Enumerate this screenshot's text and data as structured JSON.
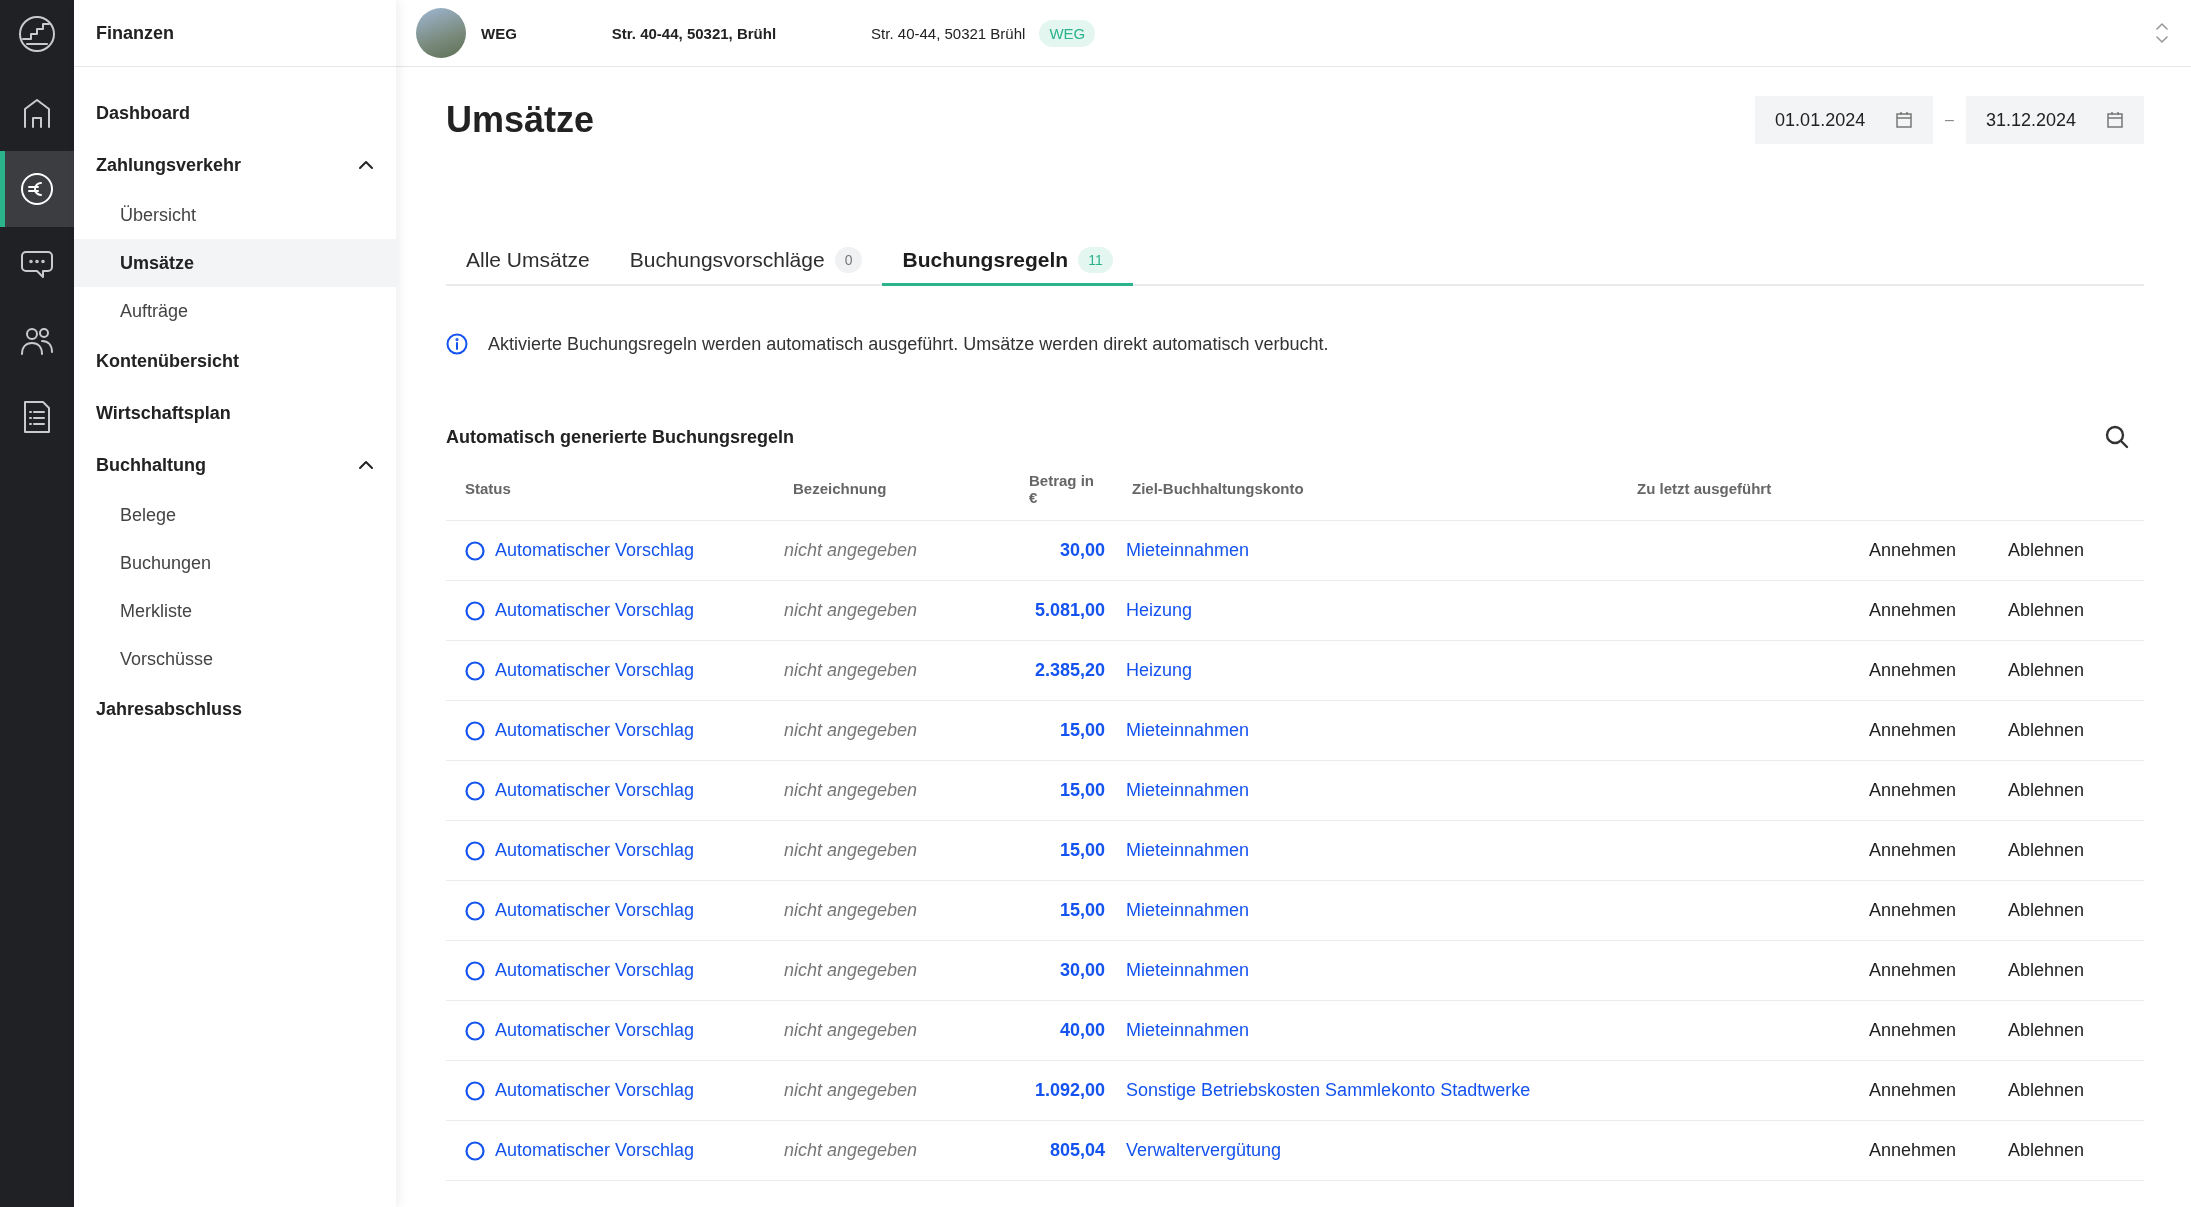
{
  "rail": [
    {
      "kind": "logo",
      "selected": false
    },
    {
      "kind": "home",
      "selected": false
    },
    {
      "kind": "euro",
      "selected": true
    },
    {
      "kind": "chat",
      "selected": false
    },
    {
      "kind": "people",
      "selected": false
    },
    {
      "kind": "document",
      "selected": false
    }
  ],
  "sidebar": {
    "title": "Finanzen",
    "items": [
      {
        "label": "Dashboard",
        "selected": false
      },
      {
        "label": "Zahlungsverkehr",
        "selected": false,
        "expanded": true,
        "children": [
          {
            "label": "Übersicht",
            "selected": false
          },
          {
            "label": "Umsätze",
            "selected": true
          },
          {
            "label": "Aufträge",
            "selected": false
          }
        ]
      },
      {
        "label": "Kontenübersicht",
        "selected": false
      },
      {
        "label": "Wirtschaftsplan",
        "selected": false
      },
      {
        "label": "Buchhaltung",
        "selected": false,
        "expanded": true,
        "children": [
          {
            "label": "Belege",
            "selected": false
          },
          {
            "label": "Buchungen",
            "selected": false
          },
          {
            "label": "Merkliste",
            "selected": false
          },
          {
            "label": "Vorschüsse",
            "selected": false
          }
        ]
      },
      {
        "label": "Jahresabschluss",
        "selected": false
      }
    ]
  },
  "topbar": {
    "property_type": "WEG",
    "property_name": "Str. 40-44, 50321, Brühl",
    "address": "Str. 40-44, 50321 Brühl",
    "badge": "WEG"
  },
  "page": {
    "title": "Umsätze",
    "date_from": "01.01.2024",
    "date_separator": "–",
    "date_to": "31.12.2024"
  },
  "tabs": [
    {
      "label": "Alle Umsätze",
      "selected": false
    },
    {
      "label": "Buchungsvorschläge",
      "count": "0",
      "selected": false
    },
    {
      "label": "Buchungsregeln",
      "count": "11",
      "selected": true
    }
  ],
  "info": "Aktivierte Buchungsregeln werden automatisch ausgeführt. Umsätze werden direkt automatisch verbucht.",
  "section_title": "Automatisch generierte Buchungsregeln",
  "table": {
    "columns": [
      "Status",
      "Bezeichnung",
      "Betrag in €",
      "Ziel-Buchhaltungskonto",
      "Zu letzt ausgeführt"
    ],
    "rows": [
      {
        "status": "Automatischer Vorschlag",
        "name": "nicht angegeben",
        "amount": "30,00",
        "account": "Mieteinnahmen",
        "accept": "Annehmen",
        "reject": "Ablehnen"
      },
      {
        "status": "Automatischer Vorschlag",
        "name": "nicht angegeben",
        "amount": "5.081,00",
        "account": "Heizung",
        "accept": "Annehmen",
        "reject": "Ablehnen"
      },
      {
        "status": "Automatischer Vorschlag",
        "name": "nicht angegeben",
        "amount": "2.385,20",
        "account": "Heizung",
        "accept": "Annehmen",
        "reject": "Ablehnen"
      },
      {
        "status": "Automatischer Vorschlag",
        "name": "nicht angegeben",
        "amount": "15,00",
        "account": "Mieteinnahmen",
        "accept": "Annehmen",
        "reject": "Ablehnen"
      },
      {
        "status": "Automatischer Vorschlag",
        "name": "nicht angegeben",
        "amount": "15,00",
        "account": "Mieteinnahmen",
        "accept": "Annehmen",
        "reject": "Ablehnen"
      },
      {
        "status": "Automatischer Vorschlag",
        "name": "nicht angegeben",
        "amount": "15,00",
        "account": "Mieteinnahmen",
        "accept": "Annehmen",
        "reject": "Ablehnen"
      },
      {
        "status": "Automatischer Vorschlag",
        "name": "nicht angegeben",
        "amount": "15,00",
        "account": "Mieteinnahmen",
        "accept": "Annehmen",
        "reject": "Ablehnen"
      },
      {
        "status": "Automatischer Vorschlag",
        "name": "nicht angegeben",
        "amount": "30,00",
        "account": "Mieteinnahmen",
        "accept": "Annehmen",
        "reject": "Ablehnen"
      },
      {
        "status": "Automatischer Vorschlag",
        "name": "nicht angegeben",
        "amount": "40,00",
        "account": "Mieteinnahmen",
        "accept": "Annehmen",
        "reject": "Ablehnen"
      },
      {
        "status": "Automatischer Vorschlag",
        "name": "nicht angegeben",
        "amount": "1.092,00",
        "account": "Sonstige Betriebskosten Sammlekonto Stadtwerke",
        "accept": "Annehmen",
        "reject": "Ablehnen"
      },
      {
        "status": "Automatischer Vorschlag",
        "name": "nicht angegeben",
        "amount": "805,04",
        "account": "Verwaltervergütung",
        "accept": "Annehmen",
        "reject": "Ablehnen"
      }
    ]
  }
}
